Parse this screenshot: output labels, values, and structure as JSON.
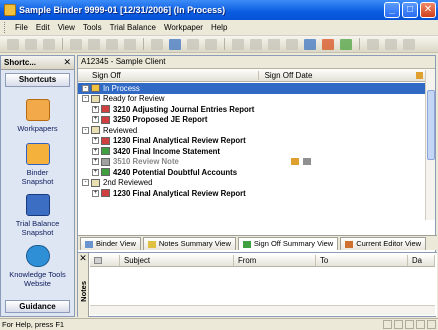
{
  "window": {
    "title": "Sample Binder 9999-01 [12/31/2006] (In Process)",
    "min": "_",
    "max": "□",
    "close": "✕"
  },
  "menu": [
    "File",
    "Edit",
    "View",
    "Tools",
    "Trial Balance",
    "Workpaper",
    "Help"
  ],
  "shortcuts": {
    "header": "Shortc...",
    "close": "✕",
    "tab": "Shortcuts",
    "items": [
      {
        "label": "Workpapers",
        "icon": "folder-icon",
        "color": "#f2a94a"
      },
      {
        "label": "Binder Snapshot",
        "icon": "snapshot-icon",
        "color": "#f4b23c"
      },
      {
        "label": "Trial Balance Snapshot",
        "icon": "tb-snapshot-icon",
        "color": "#3c6fc4"
      },
      {
        "label": "Knowledge Tools Website",
        "icon": "globe-icon",
        "color": "#2f8fd6"
      }
    ],
    "guidance": "Guidance"
  },
  "main": {
    "client": "A12345 - Sample Client",
    "columns": {
      "signoff": "Sign Off",
      "signoff_date": "Sign Off Date"
    },
    "rows": [
      {
        "text": "In Process",
        "style": "sel",
        "indent": 1,
        "exp": "-"
      },
      {
        "text": "Ready for Review",
        "style": "",
        "indent": 1,
        "exp": "-"
      },
      {
        "text": "3210 Adjusting Journal Entries Report",
        "style": "bold",
        "indent": 2,
        "exp": "+"
      },
      {
        "text": "3250 Proposed JE Report",
        "style": "bold",
        "indent": 2,
        "exp": "+"
      },
      {
        "text": "Reviewed",
        "style": "",
        "indent": 1,
        "exp": "-"
      },
      {
        "text": "1230 Final Analytical Review Report",
        "style": "bold",
        "indent": 2,
        "exp": "+"
      },
      {
        "text": "3420 Final Income Statement",
        "style": "bold",
        "indent": 2,
        "exp": "+"
      },
      {
        "text": "3510 Review Note",
        "style": "grey",
        "indent": 2,
        "exp": "+"
      },
      {
        "text": "4240 Potential Doubtful Accounts",
        "style": "bold",
        "indent": 2,
        "exp": "+"
      },
      {
        "text": "2nd Reviewed",
        "style": "",
        "indent": 1,
        "exp": "-"
      },
      {
        "text": "1230 Final Analytical Review Report",
        "style": "bold",
        "indent": 2,
        "exp": "+"
      }
    ],
    "tabs": [
      "Binder View",
      "Notes Summary View",
      "Sign Off Summary View",
      "Current Editor View"
    ]
  },
  "notes": {
    "label": "Notes",
    "close": "✕",
    "columns": [
      "Subject",
      "From",
      "To",
      "Da"
    ]
  },
  "status": {
    "text": "For Help, press F1"
  }
}
